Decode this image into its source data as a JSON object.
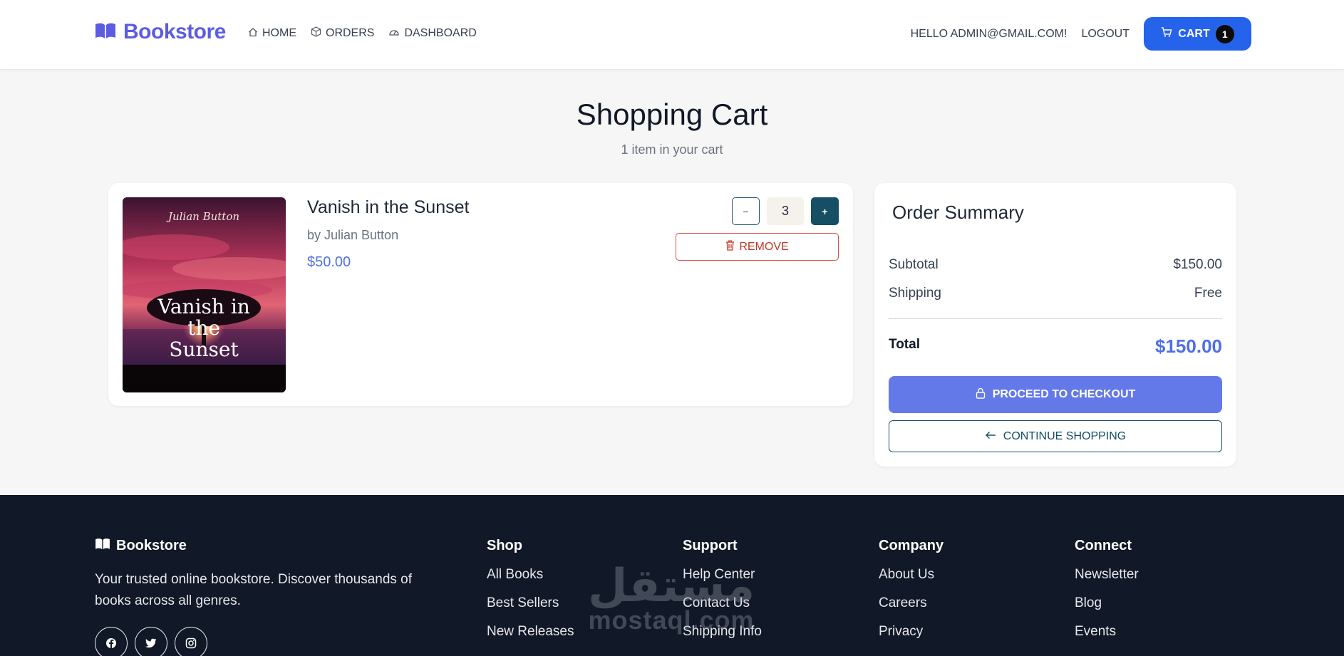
{
  "nav": {
    "brand": "Bookstore",
    "links": [
      "HOME",
      "ORDERS",
      "DASHBOARD"
    ],
    "greeting": "HELLO ADMIN@GMAIL.COM!",
    "logout": "LOGOUT",
    "cart_label": "CART",
    "cart_count": "1"
  },
  "page": {
    "title": "Shopping Cart",
    "subtitle": "1 item in your cart"
  },
  "item": {
    "title": "Vanish in the Sunset",
    "author": "by Julian Button",
    "price": "$50.00",
    "quantity": "3",
    "minus": "−",
    "plus": "+",
    "remove": "REMOVE",
    "cover": {
      "author": "Julian Button",
      "title_line1": "Vanish in",
      "title_line2": "the",
      "title_line3": "Sunset"
    }
  },
  "summary": {
    "title": "Order Summary",
    "subtotal_label": "Subtotal",
    "subtotal_value": "$150.00",
    "shipping_label": "Shipping",
    "shipping_value": "Free",
    "total_label": "Total",
    "total_value": "$150.00",
    "checkout": "PROCEED TO CHECKOUT",
    "continue": "CONTINUE SHOPPING"
  },
  "footer": {
    "brand": "Bookstore",
    "description": "Your trusted online bookstore. Discover thousands of books across all genres.",
    "shop": {
      "title": "Shop",
      "links": [
        "All Books",
        "Best Sellers",
        "New Releases"
      ]
    },
    "support": {
      "title": "Support",
      "links": [
        "Help Center",
        "Contact Us",
        "Shipping Info"
      ]
    },
    "company": {
      "title": "Company",
      "links": [
        "About Us",
        "Careers",
        "Privacy"
      ]
    },
    "connect": {
      "title": "Connect",
      "links": [
        "Newsletter",
        "Blog",
        "Events"
      ]
    },
    "watermark_arabic": "مستقل",
    "watermark_latin": "mostaql.com"
  },
  "icons": [
    "book-icon",
    "home-icon",
    "box-icon",
    "gauge-icon",
    "cart-icon",
    "trash-icon",
    "lock-icon",
    "arrow-left-icon",
    "facebook-icon",
    "twitter-icon",
    "instagram-icon"
  ],
  "colors": {
    "brand": "#5b5ce2",
    "cart_button": "#2563eb",
    "price": "#4f6fe8",
    "checkout": "#6479e8",
    "remove": "#dc4b43",
    "footer": "#111827",
    "teal": "#164e63"
  }
}
